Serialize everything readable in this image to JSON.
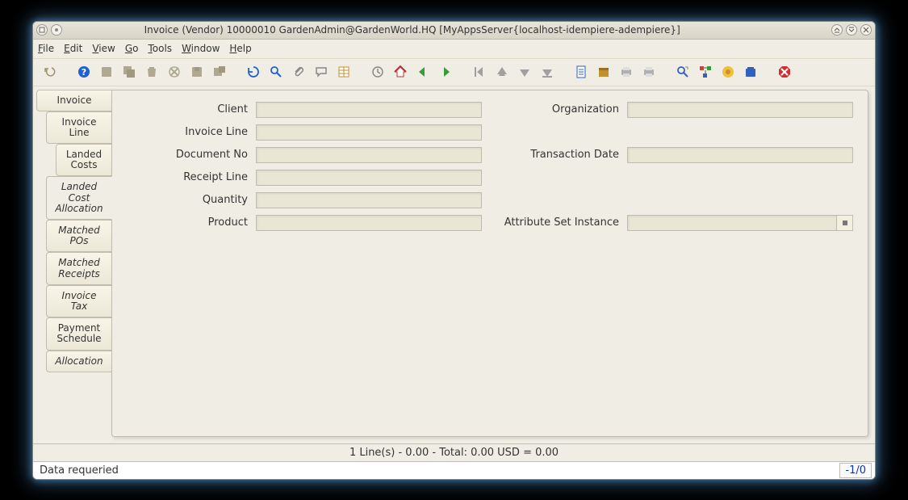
{
  "window": {
    "title": "Invoice (Vendor)  10000010  GardenAdmin@GardenWorld.HQ [MyAppsServer{localhost-idempiere-adempiere}]"
  },
  "menu": {
    "file": "File",
    "edit": "Edit",
    "view": "View",
    "go": "Go",
    "tools": "Tools",
    "window": "Window",
    "help": "Help"
  },
  "tabs": {
    "invoice": "Invoice",
    "invoice_line": "Invoice Line",
    "landed_costs": "Landed Costs",
    "landed_cost_allocation": "Landed Cost Allocation",
    "matched_pos": "Matched POs",
    "matched_receipts": "Matched Receipts",
    "invoice_tax": "Invoice Tax",
    "payment_schedule": "Payment Schedule",
    "allocation": "Allocation"
  },
  "form": {
    "client_label": "Client",
    "organization_label": "Organization",
    "invoice_line_label": "Invoice Line",
    "document_no_label": "Document No",
    "transaction_date_label": "Transaction Date",
    "receipt_line_label": "Receipt Line",
    "quantity_label": "Quantity",
    "product_label": "Product",
    "attribute_set_instance_label": "Attribute Set Instance",
    "client_value": "",
    "organization_value": "",
    "invoice_line_value": "",
    "document_no_value": "",
    "transaction_date_value": "",
    "receipt_line_value": "",
    "quantity_value": "",
    "product_value": "",
    "attribute_set_instance_value": ""
  },
  "summary": "1 Line(s) - 0.00 -  Total: 0.00  USD  =  0.00",
  "status": {
    "left": "Data requeried",
    "right": "-1/0"
  }
}
